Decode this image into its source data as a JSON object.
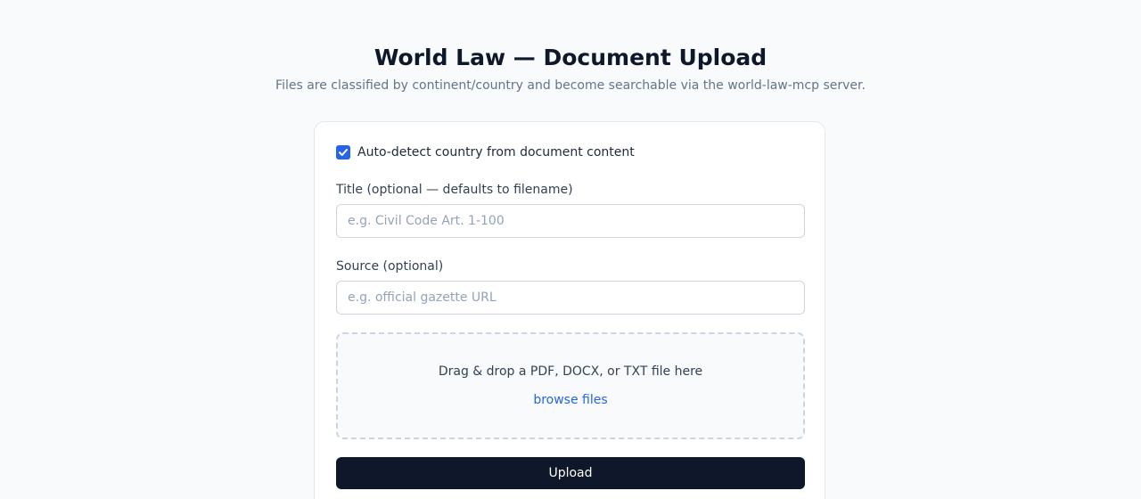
{
  "header": {
    "title": "World Law — Document Upload",
    "subtitle": "Files are classified by continent/country and become searchable via the world-law-mcp server."
  },
  "form": {
    "auto_detect": {
      "label": "Auto-detect country from document content",
      "checked": true
    },
    "title_field": {
      "label": "Title (optional — defaults to filename)",
      "placeholder": "e.g. Civil Code Art. 1-100",
      "value": ""
    },
    "source_field": {
      "label": "Source (optional)",
      "placeholder": "e.g. official gazette URL",
      "value": ""
    },
    "dropzone": {
      "text": "Drag & drop a PDF, DOCX, or TXT file here",
      "browse_label": "browse files"
    },
    "upload_label": "Upload"
  },
  "colors": {
    "accent": "#2563eb",
    "button_bg": "#0f172a",
    "page_bg": "#f8fafc"
  }
}
